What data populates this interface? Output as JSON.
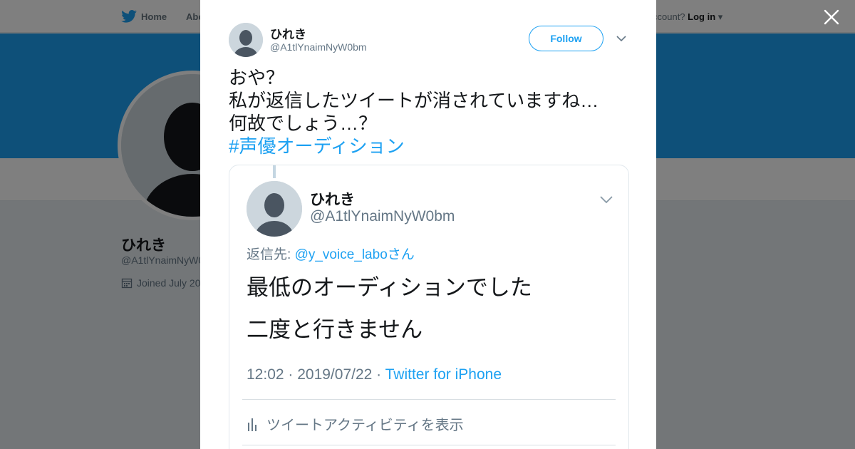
{
  "nav": {
    "home_label": "Home",
    "about_label": "Abo",
    "login_prompt": "ccount?",
    "login_label": "Log in",
    "close_icon": "close-icon",
    "bird_icon": "twitter-bird-icon"
  },
  "profile": {
    "name": "ひれき",
    "handle": "@A1tlYnaimNyW0",
    "joined": "Joined July 20"
  },
  "tweet": {
    "author_name": "ひれき",
    "author_handle": "@A1tlYnaimNyW0bm",
    "follow_label": "Follow",
    "lines": [
      "おや？",
      "私が返信したツイートが消されていますね…",
      "何故でしょう…？"
    ],
    "hashtag": "#声優オーディション"
  },
  "embedded": {
    "author_name": "ひれき",
    "author_handle": "@A1tlYnaimNyW0bm",
    "reply_prefix": "返信先: ",
    "reply_mention": "@y_voice_laboさん",
    "line1": "最低のオーディションでした",
    "line2": "二度と行きません",
    "meta_time": "12:02 · 2019/07/22 · ",
    "meta_via": "Twitter for iPhone",
    "activity_label": "ツイートアクティビティを表示"
  },
  "colors": {
    "accent": "#1da1f2",
    "text": "#14171a",
    "muted": "#657786"
  }
}
